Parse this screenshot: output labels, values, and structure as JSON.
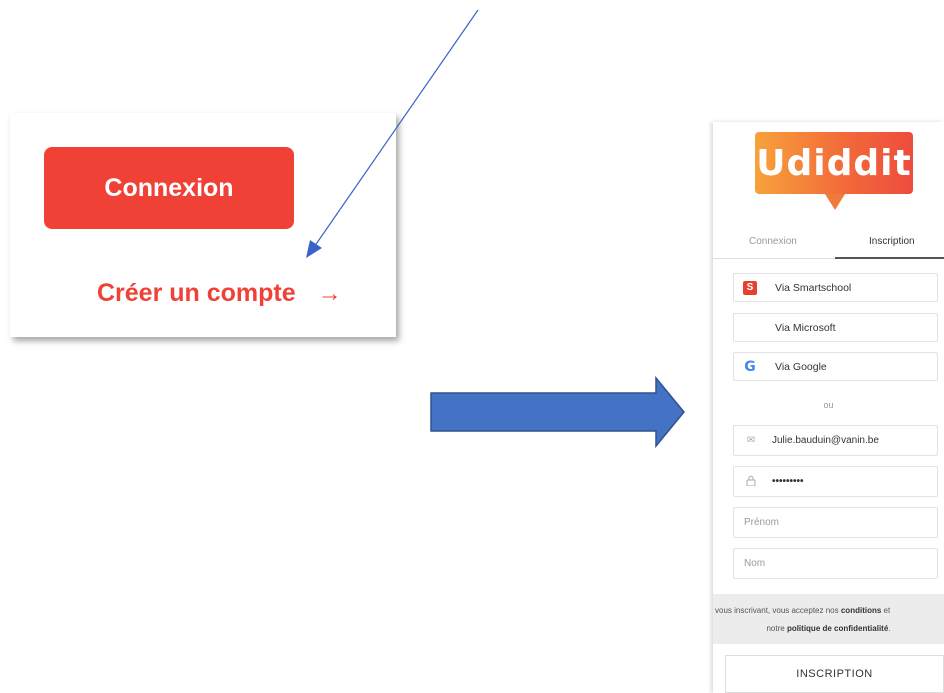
{
  "left": {
    "connexion_label": "Connexion",
    "create_account_label": "Créer un compte",
    "create_account_arrow": "→"
  },
  "signup": {
    "logo_text": "Udiddit",
    "tabs": [
      {
        "label": "Connexion",
        "active": false
      },
      {
        "label": "Inscription",
        "active": true
      }
    ],
    "providers": [
      {
        "label": "Via Smartschool",
        "icon": "smartschool-icon"
      },
      {
        "label": "Via Microsoft",
        "icon": "microsoft-icon"
      },
      {
        "label": "Via Google",
        "icon": "google-icon"
      }
    ],
    "separator": "ou",
    "email_value": "Julie.bauduin@vanin.be",
    "password_value": "•••••••••",
    "firstname_placeholder": "Prénom",
    "lastname_placeholder": "Nom",
    "terms_prefix": "En vous inscrivant, vous acceptez nos",
    "terms_link1": "conditions",
    "terms_join": "et",
    "terms_line2_prefix": "notre",
    "terms_link2": "politique de confidentialité",
    "terms_suffix": ".",
    "submit_label": "INSCRIPTION"
  },
  "colors": {
    "brand_red": "#ef4136",
    "arrow_blue": "#4472c4",
    "line_blue": "#3a62c8"
  }
}
